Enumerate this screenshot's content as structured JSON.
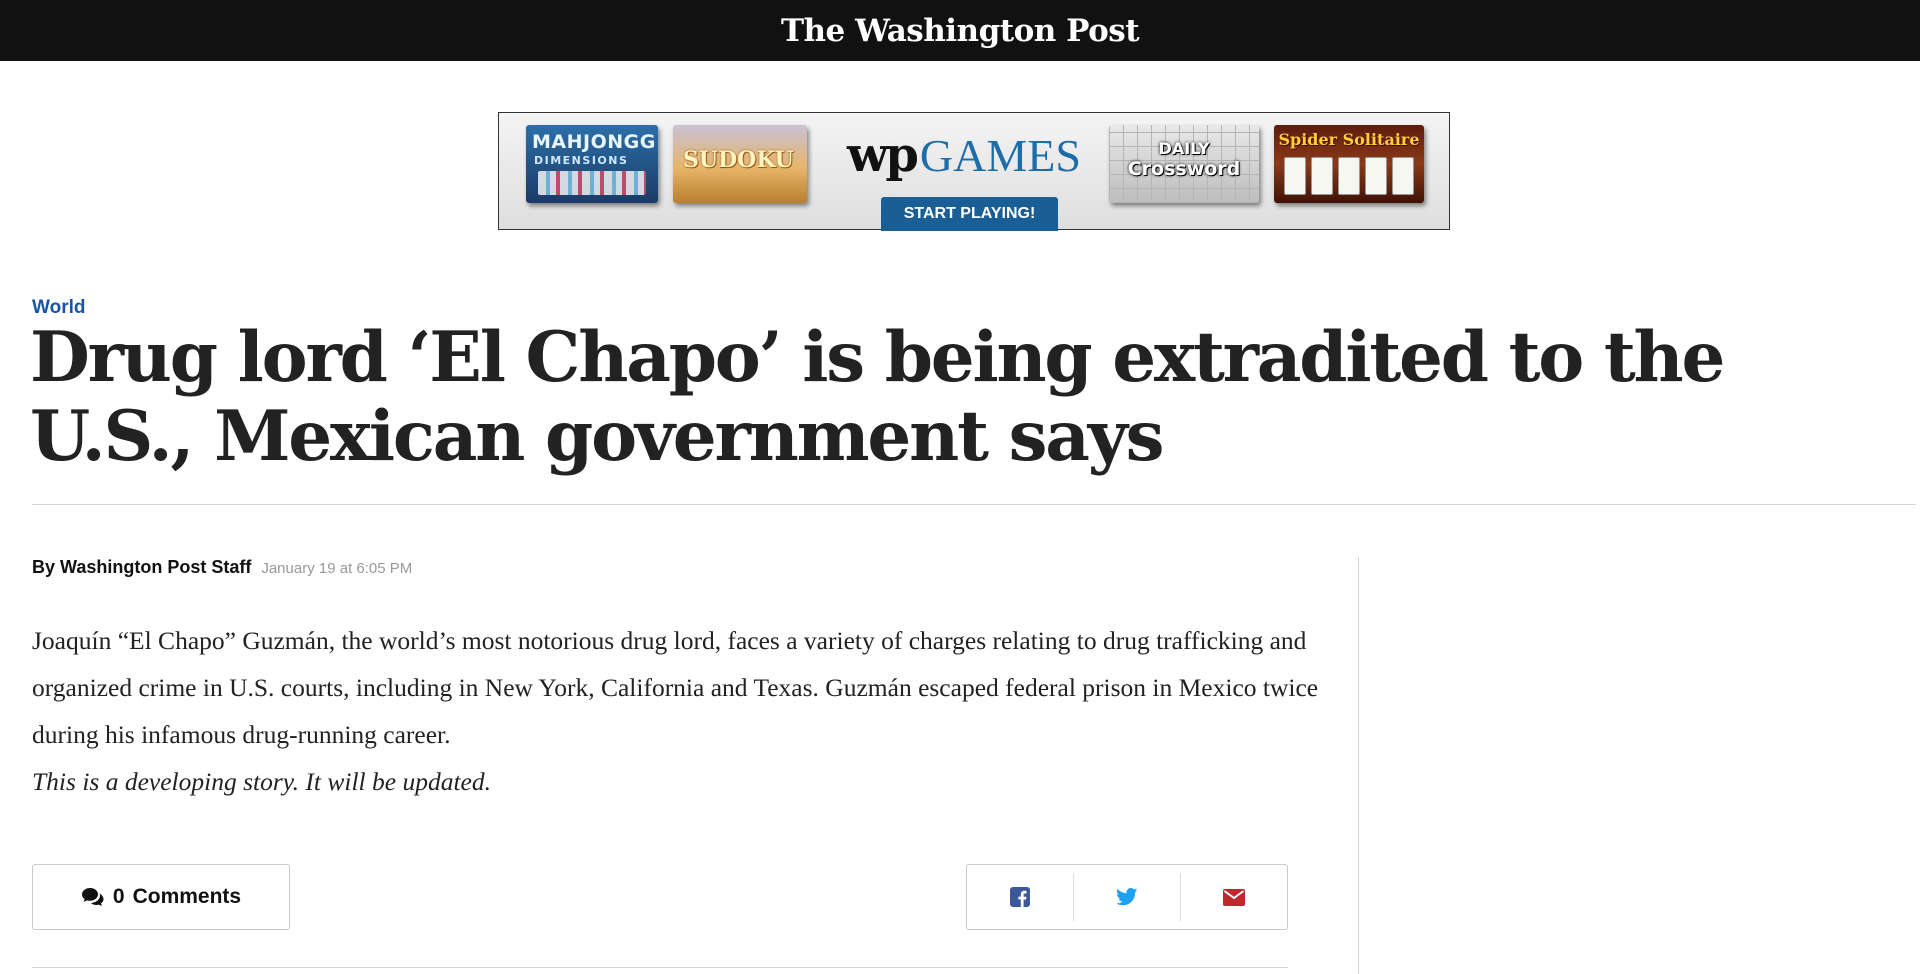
{
  "header": {
    "masthead": "The Washington Post"
  },
  "ad": {
    "tiles": {
      "mahjongg_line1": "MAHJONGG",
      "mahjongg_line2": "DIMENSIONS",
      "sudoku": "SUDOKU",
      "crossword_line1": "DAILY",
      "crossword_line2": "Crossword",
      "spider": "Spider Solitaire"
    },
    "logo_wp": "wp",
    "logo_games": "GAMES",
    "cta": "START PLAYING!"
  },
  "article": {
    "kicker": "World",
    "headline": "Drug lord ‘El Chapo’ is being extradited to the U.S., Mexican government says",
    "byline_author": "By Washington Post Staff",
    "byline_date": "January 19 at 6:05 PM",
    "body": "Joaquín “El Chapo” Guzmán, the world’s most notorious drug lord, faces a variety of charges relating to drug trafficking and organized crime in U.S. courts, including in New York, California and Texas. Guzmán escaped federal prison in Mexico twice during his infamous drug-running career.",
    "note": "This is a developing story. It will be updated."
  },
  "actions": {
    "comments_count": "0",
    "comments_label": "Comments",
    "share_icons": [
      "facebook-icon",
      "twitter-icon",
      "email-icon"
    ]
  },
  "colors": {
    "kicker": "#1955a5",
    "facebook": "#3b5998",
    "twitter": "#1da1f2",
    "email": "#c0272d"
  }
}
